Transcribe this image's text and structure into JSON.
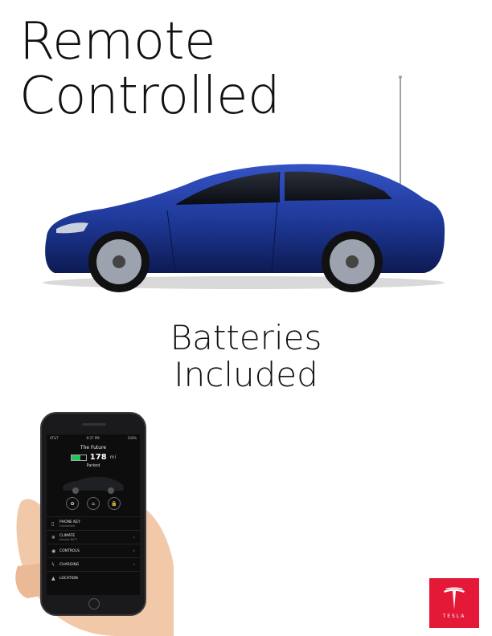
{
  "headline": {
    "line1": "Remote",
    "line2": "Controlled"
  },
  "tagline": {
    "line1": "Batteries",
    "line2": "Included"
  },
  "phone": {
    "status": {
      "carrier": "AT&T",
      "time": "8:37 PM",
      "indicators": "100%"
    },
    "car_name": "The Future",
    "range_value": "178",
    "range_unit": "mi",
    "battery_level": 0.6,
    "state": "Parked",
    "controls": [
      {
        "icon": "fan-icon",
        "glyph": "✿"
      },
      {
        "icon": "frunk-icon",
        "glyph": "⌂"
      },
      {
        "icon": "lock-icon",
        "glyph": "🔒"
      }
    ],
    "menu": [
      {
        "icon": "phone-icon",
        "glyph": "▯",
        "label": "PHONE KEY",
        "sub": "Connected"
      },
      {
        "icon": "climate-icon",
        "glyph": "❄",
        "label": "CLIMATE",
        "sub": "Interior 80°F"
      },
      {
        "icon": "controls-icon",
        "glyph": "◉",
        "label": "CONTROLS",
        "sub": ""
      },
      {
        "icon": "charging-icon",
        "glyph": "ϟ",
        "label": "CHARGING",
        "sub": ""
      },
      {
        "icon": "location-icon",
        "glyph": "▲",
        "label": "LOCATION",
        "sub": ""
      }
    ]
  },
  "logo": {
    "wordmark": "TESLA"
  },
  "colors": {
    "car_blue": "#1f3a9a",
    "tesla_red": "#e31937",
    "battery_green": "#22c55e"
  }
}
